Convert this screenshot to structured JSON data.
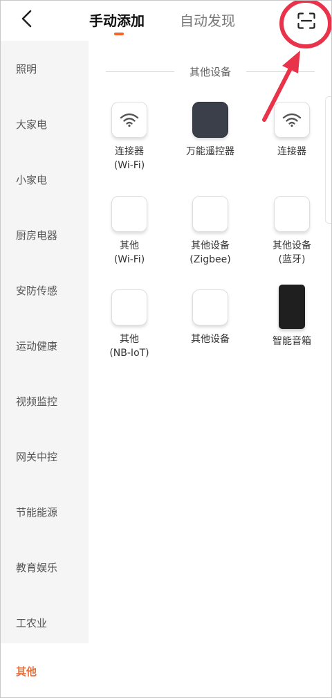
{
  "header": {
    "tabs": [
      {
        "label": "手动添加",
        "active": true
      },
      {
        "label": "自动发现",
        "active": false
      }
    ],
    "accent_color": "#f2652b"
  },
  "sidebar": {
    "items": [
      {
        "label": "照明"
      },
      {
        "label": "大家电"
      },
      {
        "label": "小家电"
      },
      {
        "label": "厨房电器"
      },
      {
        "label": "安防传感"
      },
      {
        "label": "运动健康"
      },
      {
        "label": "视频监控"
      },
      {
        "label": "网关中控"
      },
      {
        "label": "节能能源"
      },
      {
        "label": "教育娱乐"
      },
      {
        "label": "工农业"
      },
      {
        "label": "其他",
        "active": true
      }
    ]
  },
  "content": {
    "section_title": "其他设备",
    "devices": [
      {
        "line1": "连接器",
        "line2": "(Wi-Fi)",
        "icon": "wifi-icon"
      },
      {
        "line1": "万能遥控器",
        "line2": "",
        "icon": "remote-icon"
      },
      {
        "line1": "连接器",
        "line2": "",
        "icon": "wifi-icon"
      },
      {
        "line1": "其他",
        "line2": "(Wi-Fi)",
        "icon": "device-icon"
      },
      {
        "line1": "其他设备",
        "line2": "(Zigbee)",
        "icon": "device-icon"
      },
      {
        "line1": "其他设备",
        "line2": "(蓝牙)",
        "icon": "device-icon"
      },
      {
        "line1": "其他",
        "line2": "(NB-IoT)",
        "icon": "device-icon"
      },
      {
        "line1": "其他设备",
        "line2": "",
        "icon": "device-icon"
      },
      {
        "line1": "智能音箱",
        "line2": "",
        "icon": "speaker-icon"
      }
    ]
  },
  "annotation": {
    "color": "#e8334a"
  }
}
